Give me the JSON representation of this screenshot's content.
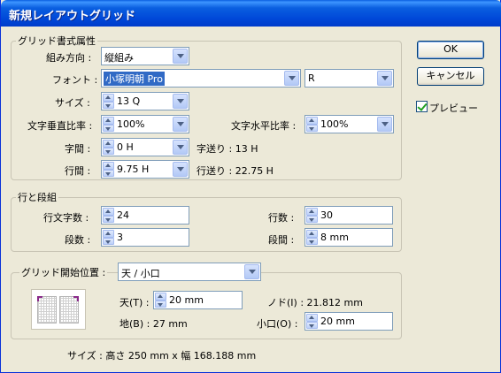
{
  "title": "新規レイアウトグリッド",
  "grid_attrs": {
    "group_label": "グリッド書式属性",
    "direction_label": "組み方向 :",
    "direction_value": "縦組み",
    "font_label": "フォント :",
    "font_family": "小塚明朝 Pro",
    "font_style": "R",
    "size_label": "サイズ :",
    "size_value": "13 Q",
    "vscale_label": "文字垂直比率 :",
    "vscale_value": "100%",
    "hscale_label": "文字水平比率 :",
    "hscale_value": "100%",
    "char_space_label": "字間 :",
    "char_space_value": "0 H",
    "char_pitch_text": "字送り : 13 H",
    "line_space_label": "行間 :",
    "line_space_value": "9.75 H",
    "line_pitch_text": "行送り : 22.75 H"
  },
  "lines_columns": {
    "group_label": "行と段組",
    "chars_per_line_label": "行文字数 :",
    "chars_per_line_value": "24",
    "lines_label": "行数 :",
    "lines_value": "30",
    "columns_label": "段数 :",
    "columns_value": "3",
    "gutter_label": "段間 :",
    "gutter_value": "8 mm"
  },
  "start_position": {
    "label": "グリッド開始位置 :",
    "value": "天 / 小口",
    "top_label": "天(T) :",
    "top_value": "20 mm",
    "bottom_text": "地(B) : 27 mm",
    "inside_text": "ノド(I) : 21.812 mm",
    "outside_label": "小口(O) :",
    "outside_value": "20 mm"
  },
  "size_text": "サイズ : 高さ 250 mm x 幅 168.188 mm",
  "buttons": {
    "ok": "OK",
    "cancel": "キャンセル"
  },
  "preview_label": "プレビュー",
  "colors": {
    "titlebar": "#0a5fe0",
    "dialog_bg": "#ece9d8",
    "selection": "#316ac5",
    "preview_mark": "#8a2a8a"
  }
}
